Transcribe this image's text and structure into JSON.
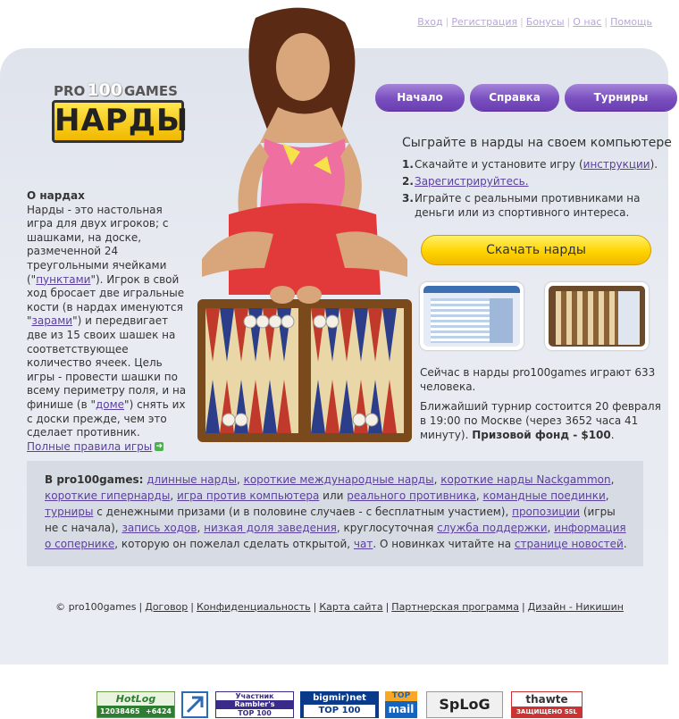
{
  "top_links": [
    "Вход",
    "Регистрация",
    "Бонусы",
    "О нас",
    "Помощь"
  ],
  "logo": {
    "pro": "PRO",
    "num": "100",
    "games": "GAMES",
    "main": "НАРДЫ"
  },
  "nav": [
    {
      "label": "Начало"
    },
    {
      "label": "Справка"
    },
    {
      "label": "Турниры"
    }
  ],
  "headline": "Сыграйте в нарды на своем компьютере",
  "steps": [
    {
      "num": "1.",
      "pre": "Скачайте и установите игру (",
      "link": "инструкции",
      "post": ")."
    },
    {
      "num": "2.",
      "pre": "",
      "link": "Зарегистрируйтесь.",
      "post": ""
    },
    {
      "num": "3.",
      "pre": "Играйте с реальными противниками на деньги или из спортивного интереса.",
      "link": "",
      "post": ""
    }
  ],
  "download_button": "Скачать нарды",
  "online": {
    "players": "Сейчас в нарды pro100games играют 633 человека.",
    "tournament_pre": "Ближайший турнир состоится 20 февраля в 19:00 по Москве (через 3652 часа 41 минуту). ",
    "tournament_prize": "Призовой фонд - $100",
    "tournament_end": "."
  },
  "about": {
    "title": "О нардах",
    "t1": "Нарды - это настольная игра для двух игроков; с шашками, на доске, размеченной 24 треугольными ячейками (\"",
    "l1": "пунктами",
    "t2": "\"). Игрок в свой ход бросает две игральные кости (в нардах именуются \"",
    "l2": "зарами",
    "t3": "\") и передвигает две из 15 своих шашек на соответствующее количество ячеек. Цель игры - провести шашки по всему периметру поля, и на финише (в \"",
    "l3": "доме",
    "t4": "\") снять их с доски прежде, чем это сделает противник.",
    "rules_link": "Полные правила игры"
  },
  "info": {
    "lead": "В pro100games:",
    "l_long": "длинные нарды",
    "l_short_int": "короткие международные нарды",
    "l_nack": "короткие нарды Nackgammon",
    "l_hyper": "короткие гипернарды",
    "l_comp": "игра против компьютера",
    "or": " или ",
    "l_real": "реального противника",
    "l_team": "командные поединки",
    "l_tourn": "турниры",
    "t_prizes": " с денежными призами (и в половине случаев - с бесплатным участием), ",
    "l_prop": "пропозиции",
    "t_prop": " (игры не с начала),",
    "l_rec": "запись ходов",
    "l_rake": "низкая доля заведения",
    "t_support": ", круглосуточная ",
    "l_support": "служба поддержки",
    "l_opp": "информация о сопернике",
    "t_post": ", которую он пожелал сделать открытой, ",
    "l_chat": "чат",
    "t_news": ". О новинках читайте на ",
    "l_news": "странице новостей",
    "t_end": "."
  },
  "footer": {
    "copy": "© pro100games",
    "links": [
      "Договор",
      "Конфиденциальность",
      "Карта сайта",
      "Партнерская программа",
      "Дизайн - Никишин"
    ]
  },
  "badges": {
    "hotlog": "HotLog",
    "hotlog_n1": "12038465",
    "hotlog_n2": "+6424",
    "rambler_1": "Участник",
    "rambler_2": "Rambler's",
    "rambler_3": "TOP 100",
    "bigmir": "bigmir)net",
    "bigmir_top": "TOP 100",
    "topmail_1": "TOP",
    "topmail_2": "mail",
    "splog": "SpLoG",
    "thawte": "thawte",
    "thawte_sub": "ЗАЩИЩЕНО SSL"
  },
  "colors": {
    "accent_purple": "#7a4fc0",
    "download_yellow": "#ffd400",
    "link": "#5b3f9e"
  }
}
